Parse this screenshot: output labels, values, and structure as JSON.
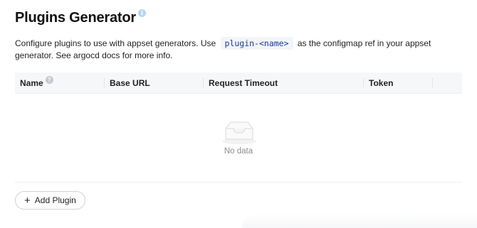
{
  "header": {
    "title": "Plugins Generator",
    "info_icon": "info-icon"
  },
  "description": {
    "before": "Configure plugins to use with appset generators. Use",
    "code": "plugin-<name>",
    "after": "as the configmap ref in your appset generator. See argocd docs for more info."
  },
  "table": {
    "columns": [
      {
        "label": "Name",
        "help_icon": "question-icon"
      },
      {
        "label": "Base URL"
      },
      {
        "label": "Request Timeout"
      },
      {
        "label": "Token"
      },
      {
        "label": ""
      }
    ],
    "rows": [],
    "empty_icon": "empty-inbox-icon",
    "empty_text": "No data"
  },
  "actions": {
    "add_label": "Add Plugin",
    "add_icon": "plus-icon"
  },
  "colors": {
    "code_text": "#1a3a9c",
    "code_bg": "#f3f5f8",
    "header_bg": "#f6f7f9",
    "info_icon": "#b9d4f4"
  }
}
